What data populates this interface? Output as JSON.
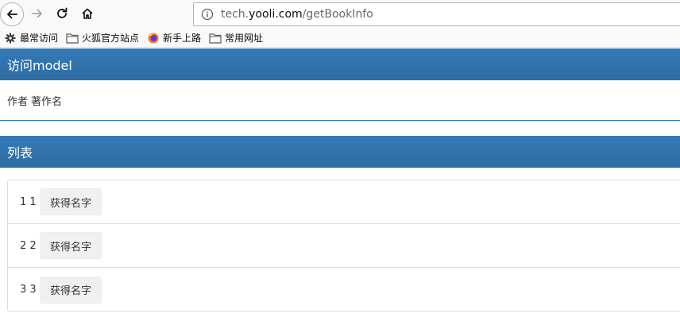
{
  "browser": {
    "url_prefix": "tech.",
    "url_domain": "yooli.com",
    "url_path": "/getBookInfo",
    "bookmarks": [
      {
        "label": "最常访问",
        "icon": "gear-icon"
      },
      {
        "label": "火狐官方站点",
        "icon": "folder-icon"
      },
      {
        "label": "新手上路",
        "icon": "firefox-icon"
      },
      {
        "label": "常用网址",
        "icon": "folder-icon"
      }
    ]
  },
  "model_section": {
    "title": "访问model",
    "author": "作者",
    "book_name": "著作名"
  },
  "list_section": {
    "title": "列表",
    "items": [
      {
        "index": "1 1",
        "button_label": "获得名字"
      },
      {
        "index": "2 2",
        "button_label": "获得名字"
      },
      {
        "index": "3 3",
        "button_label": "获得名字"
      }
    ]
  },
  "colors": {
    "panel_heading": "#337ab7",
    "toolbar_bg": "#f9f9fa",
    "button_bg": "#f0f0f0"
  }
}
